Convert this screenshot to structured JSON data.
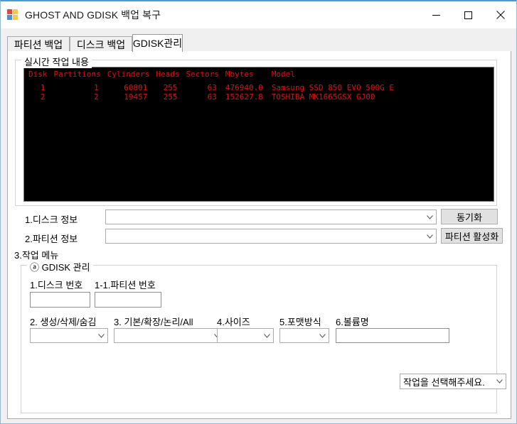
{
  "window": {
    "title": "GHOST AND GDISK 백업 복구",
    "icon": "app-icon",
    "minimize_label": "—",
    "maximize_label": "□",
    "close_label": "✕"
  },
  "tabs": [
    {
      "label": "파티션 백업",
      "selected": false
    },
    {
      "label": "디스크 백업",
      "selected": false
    },
    {
      "label": "GDISK관리",
      "selected": true
    }
  ],
  "realtime_group": {
    "title": "실시간 작업 내용",
    "console": {
      "headers": [
        "Disk",
        "Partitions",
        "Cylinders",
        "Heads",
        "Sectors",
        "Mbytes",
        "Model"
      ],
      "rows": [
        {
          "disk": "1",
          "partitions": "1",
          "cylinders": "60801",
          "heads": "255",
          "sectors": "63",
          "mbytes": "476940.0",
          "model": "Samsung SSD 850 EVO 500G E"
        },
        {
          "disk": "2",
          "partitions": "2",
          "cylinders": "19457",
          "heads": "255",
          "sectors": "63",
          "mbytes": "152627.8",
          "model": "TOSHIBA MK1665GSX GJ00"
        }
      ],
      "text_color": "#e01010",
      "background_color": "#000000"
    }
  },
  "disk_info": {
    "label": "1.디스크 정보",
    "value": "",
    "placeholder": ""
  },
  "partition_info": {
    "label": "2.파티션 정보",
    "value": "",
    "placeholder": ""
  },
  "task_menu_label": "3.작업 메뉴",
  "sync_button": "동기화",
  "activate_partition_button": "파티션 활성화",
  "gdisk_group": {
    "title": "ⓐ GDISK 관리",
    "disk_number": {
      "label": "1.디스크 번호",
      "value": ""
    },
    "partition_number": {
      "label": "1-1.파티션 번호",
      "value": ""
    },
    "create_delete_hide": {
      "label": "2. 생성/삭제/숨김",
      "value": ""
    },
    "basic_extended_logical": {
      "label": "3. 기본/확장/논리/All",
      "value": ""
    },
    "size": {
      "label": "4.사이즈",
      "value": ""
    },
    "format_type": {
      "label": "5.포맷방식",
      "value": ""
    },
    "volume_name": {
      "label": "6.볼륨명",
      "value": ""
    },
    "action_select": {
      "value": "작업을 선택해주세요."
    }
  }
}
